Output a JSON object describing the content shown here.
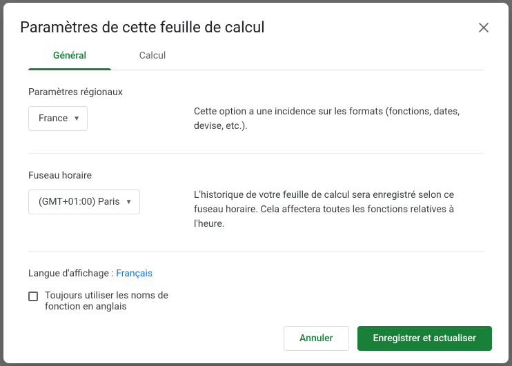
{
  "dialog": {
    "title": "Paramètres de cette feuille de calcul"
  },
  "tabs": {
    "general": "Général",
    "calcul": "Calcul"
  },
  "regional": {
    "label": "Paramètres régionaux",
    "value": "France",
    "desc": "Cette option a une incidence sur les formats (fonctions, dates, devise, etc.)."
  },
  "timezone": {
    "label": "Fuseau horaire",
    "value": "(GMT+01:00) Paris",
    "desc": "L'historique de votre feuille de calcul sera enregistré selon ce fuseau horaire. Cela affectera toutes les fonctions relatives à l'heure."
  },
  "language": {
    "label": "Langue d'affichage : ",
    "link": "Français",
    "checkbox": "Toujours utiliser les noms de fonction en anglais"
  },
  "footer": {
    "cancel": "Annuler",
    "save": "Enregistrer et actualiser"
  }
}
